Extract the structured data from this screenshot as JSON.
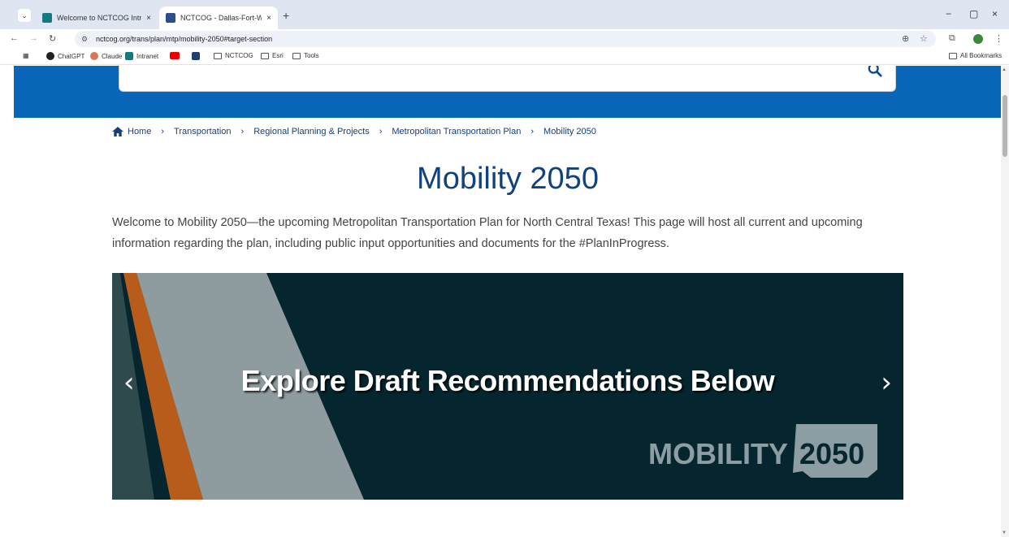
{
  "browser": {
    "tabs": [
      {
        "title": "Welcome to NCTCOG Intranet",
        "active": false
      },
      {
        "title": "NCTCOG - Dallas-Fort-Worth M",
        "active": true
      }
    ],
    "new_tab": "+",
    "close": "×",
    "window_controls": {
      "minimize": "−",
      "restore": "▢",
      "close": "×"
    },
    "url": "nctcog.org/trans/plan/mtp/mobility-2050#target-section",
    "bookmarks": [
      {
        "label": "ChatGPT",
        "icon": "chatgpt-icon"
      },
      {
        "label": "Claude",
        "icon": "claude-icon"
      },
      {
        "label": "Intranet",
        "icon": "intranet-icon"
      },
      {
        "label": "",
        "icon": "youtube-icon"
      },
      {
        "label": "",
        "icon": "app-icon"
      },
      {
        "label": "NCTCOG",
        "icon": "folder-icon"
      },
      {
        "label": "Esri",
        "icon": "folder-icon"
      },
      {
        "label": "Tools",
        "icon": "folder-icon"
      }
    ],
    "all_bookmarks": "All Bookmarks"
  },
  "breadcrumb": {
    "home": "Home",
    "items": [
      "Transportation",
      "Regional Planning & Projects",
      "Metropolitan Transportation Plan",
      "Mobility 2050"
    ],
    "separator": "›"
  },
  "page": {
    "title": "Mobility 2050",
    "intro": "Welcome to Mobility 2050—the upcoming Metropolitan Transportation Plan for North Central Texas! This page will host all current and upcoming information regarding the plan, including public input opportunities and documents for the #PlanInProgress."
  },
  "carousel": {
    "caption": "Explore Draft Recommendations Below",
    "prev": "‹",
    "next": "›",
    "logo_word": "MOBILITY",
    "logo_year": "2050"
  },
  "colors": {
    "header_blue": "#0865b8",
    "title_blue": "#10427e",
    "carousel_bg": "#05262f",
    "accent_orange": "#b85c1c"
  }
}
